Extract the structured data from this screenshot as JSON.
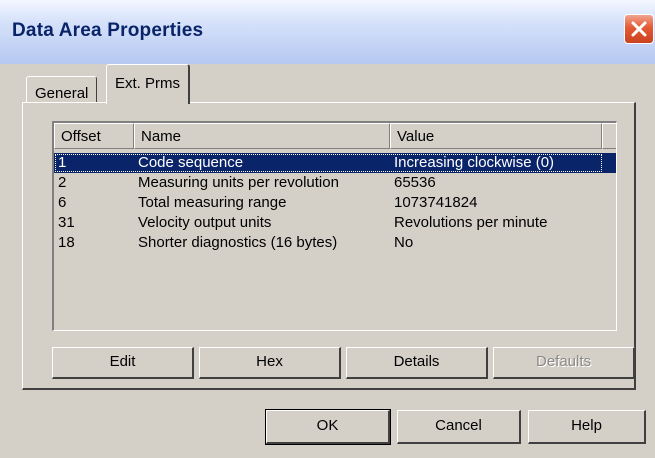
{
  "window": {
    "title": "Data Area Properties"
  },
  "tabs": [
    {
      "label": "General",
      "active": false
    },
    {
      "label": "Ext. Prms",
      "active": true
    }
  ],
  "list": {
    "columns": [
      "Offset",
      "Name",
      "Value"
    ],
    "rows": [
      {
        "offset": "1",
        "name": "Code sequence",
        "value": "Increasing clockwise (0)",
        "selected": true
      },
      {
        "offset": "2",
        "name": "Measuring units per revolution",
        "value": "65536",
        "selected": false
      },
      {
        "offset": "6",
        "name": "Total measuring range",
        "value": "1073741824",
        "selected": false
      },
      {
        "offset": "31",
        "name": "Velocity output units",
        "value": "Revolutions per minute",
        "selected": false
      },
      {
        "offset": "18",
        "name": "Shorter diagnostics (16 bytes)",
        "value": "No",
        "selected": false
      }
    ]
  },
  "panel_buttons": {
    "edit": "Edit",
    "hex": "Hex",
    "details": "Details",
    "defaults": "Defaults"
  },
  "dialog_buttons": {
    "ok": "OK",
    "cancel": "Cancel",
    "help": "Help"
  },
  "colors": {
    "title_text": "#0a246a",
    "selection": "#0a246a",
    "face": "#d4d0c8",
    "close": "#e45a34"
  },
  "icons": {
    "close": "close-icon"
  }
}
